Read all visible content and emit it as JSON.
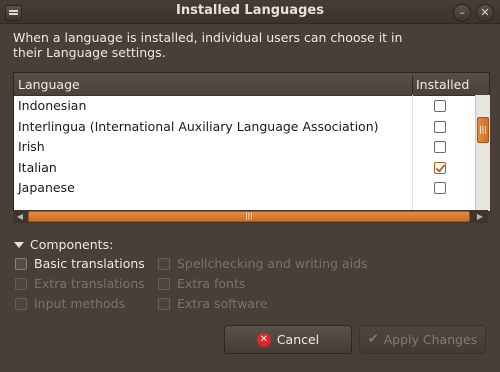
{
  "window": {
    "title": "Installed Languages",
    "close_glyph": "✕",
    "minimize_glyph": "–"
  },
  "intro_text": "When a language is installed, individual users can choose it in their Language settings.",
  "table": {
    "columns": [
      "Language",
      "Installed"
    ],
    "rows": [
      {
        "name": "Indonesian",
        "installed": false
      },
      {
        "name": "Interlingua (International Auxiliary Language Association)",
        "installed": false
      },
      {
        "name": "Irish",
        "installed": false
      },
      {
        "name": "Italian",
        "installed": true
      },
      {
        "name": "Japanese",
        "installed": false
      }
    ]
  },
  "scroll_grip": "|||",
  "components": {
    "label": "Components:",
    "options": [
      {
        "label": "Basic translations",
        "enabled": true
      },
      {
        "label": "Spellchecking and writing aids",
        "enabled": false
      },
      {
        "label": "Extra translations",
        "enabled": false
      },
      {
        "label": "Extra fonts",
        "enabled": false
      },
      {
        "label": "Input methods",
        "enabled": false
      },
      {
        "label": "Extra software",
        "enabled": false
      }
    ]
  },
  "buttons": {
    "cancel": "Cancel",
    "apply": "Apply Changes"
  },
  "icons": {
    "menu": "window-menu-icon",
    "minimize": "minimize-icon",
    "close": "close-icon",
    "cancel": "cancel-icon",
    "apply": "checkmark-icon"
  },
  "colors": {
    "accent": "#d2732a",
    "window_bg": "#4a3f37",
    "cancel_icon": "#d7282c"
  }
}
